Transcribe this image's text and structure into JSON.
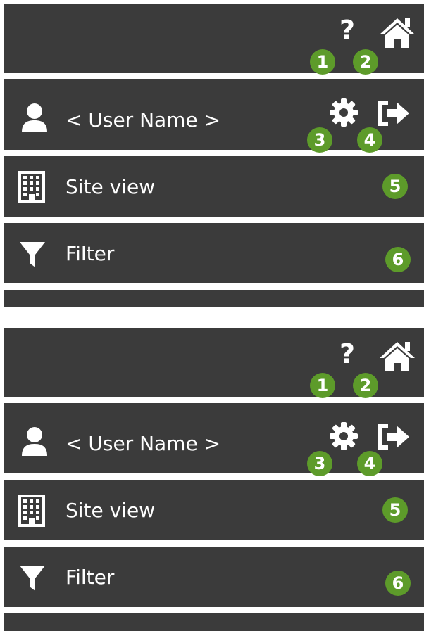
{
  "panels": [
    {
      "user": {
        "name": "< User Name >"
      },
      "menu": {
        "site_view": "Site view",
        "filter": "Filter"
      },
      "badges": {
        "help": "1",
        "home": "2",
        "settings": "3",
        "logout": "4",
        "site_view": "5",
        "filter": "6"
      }
    },
    {
      "user": {
        "name": "< User Name >"
      },
      "menu": {
        "site_view": "Site view",
        "filter": "Filter"
      },
      "badges": {
        "help": "1",
        "home": "2",
        "settings": "3",
        "logout": "4",
        "site_view": "5",
        "filter": "6"
      }
    }
  ],
  "icons": {
    "help": "question-mark-icon",
    "home": "home-icon",
    "user": "user-icon",
    "settings": "gear-icon",
    "logout": "logout-icon",
    "site_view": "building-icon",
    "filter": "filter-icon"
  },
  "colors": {
    "bar_background": "#3b3b3b",
    "separator": "#ffffff",
    "badge": "#5d9b2a",
    "icon": "#ffffff"
  }
}
